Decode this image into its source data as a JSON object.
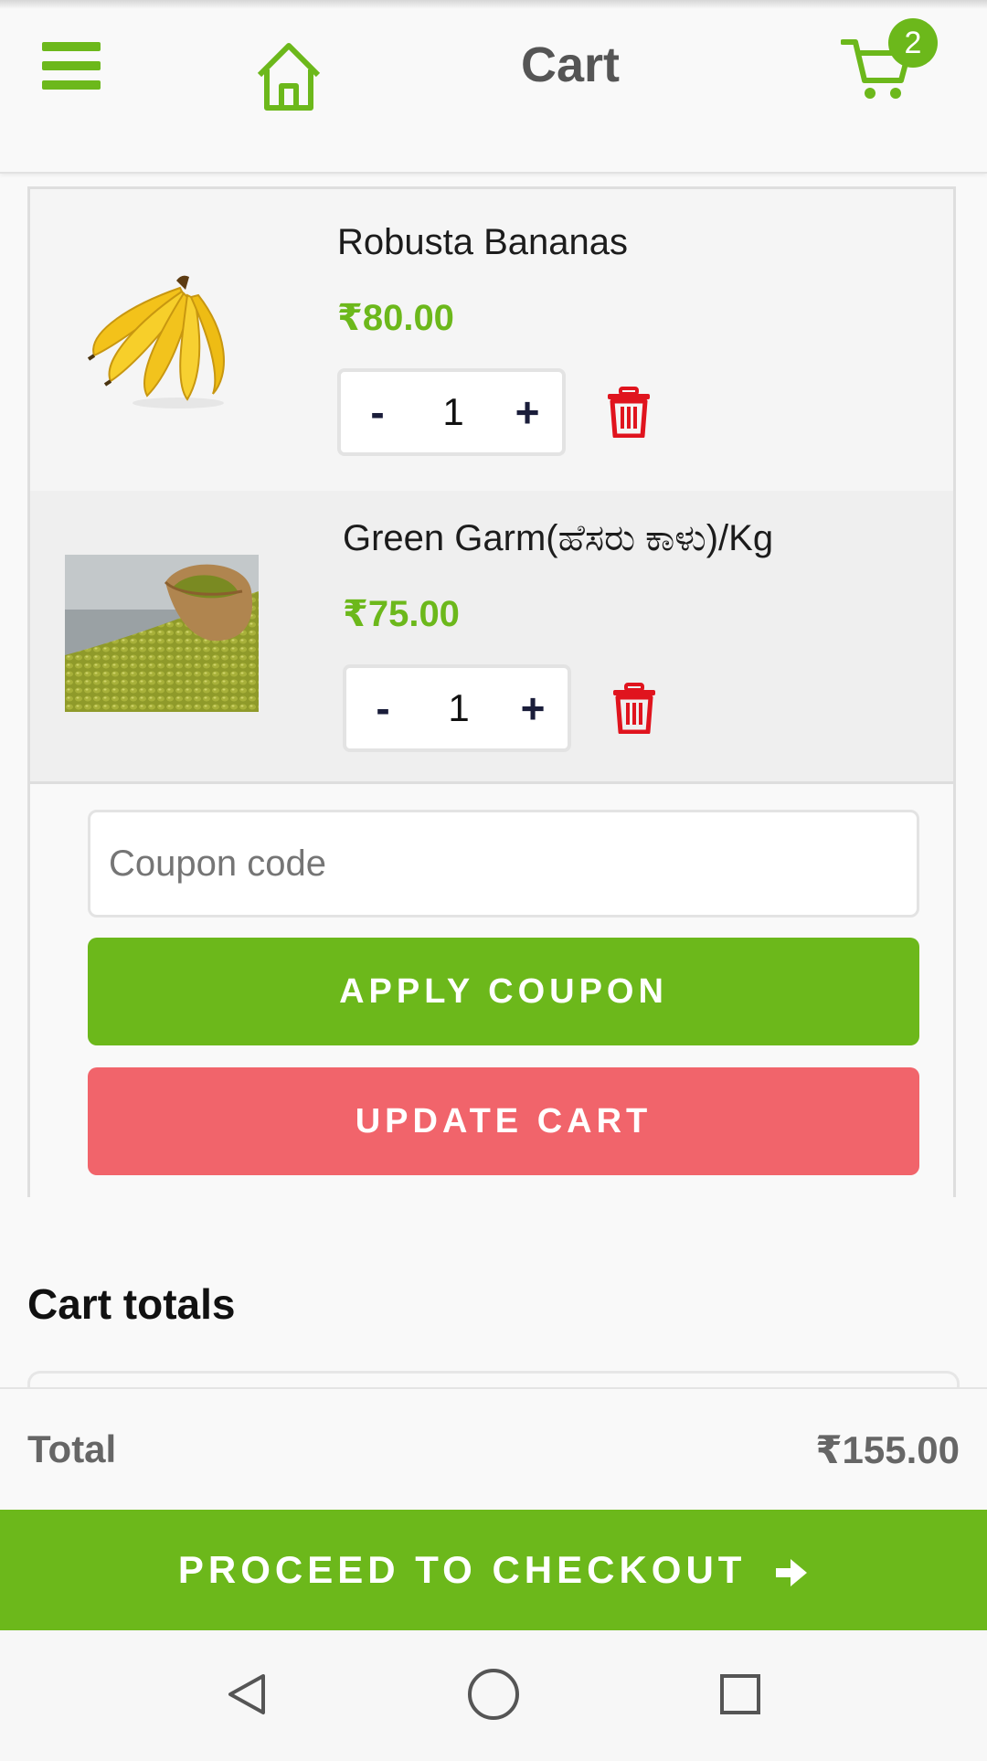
{
  "header": {
    "title": "Cart",
    "cart_count": "2",
    "icons": {
      "menu": "hamburger-menu-icon",
      "home": "home-icon",
      "cart": "shopping-cart-icon"
    }
  },
  "cart": {
    "items": [
      {
        "name": "Robusta Bananas",
        "price": "₹80.00",
        "qty": "1",
        "minus": "-",
        "plus": "+",
        "image": "bananas"
      },
      {
        "name": "Green Garm(ಹೆಸರು ಕಾಳು)/Kg",
        "price": "₹75.00",
        "qty": "1",
        "minus": "-",
        "plus": "+",
        "image": "green-gram-sack"
      }
    ],
    "coupon_placeholder": "Coupon code",
    "apply_coupon_label": "APPLY COUPON",
    "update_cart_label": "UPDATE CART"
  },
  "totals": {
    "heading": "Cart totals",
    "total_label": "Total",
    "total_value": "₹155.00",
    "checkout_label": "PROCEED TO CHECKOUT"
  },
  "colors": {
    "brand_green": "#6cb81b",
    "update_red": "#f1646b",
    "trash_red": "#e0141e"
  }
}
